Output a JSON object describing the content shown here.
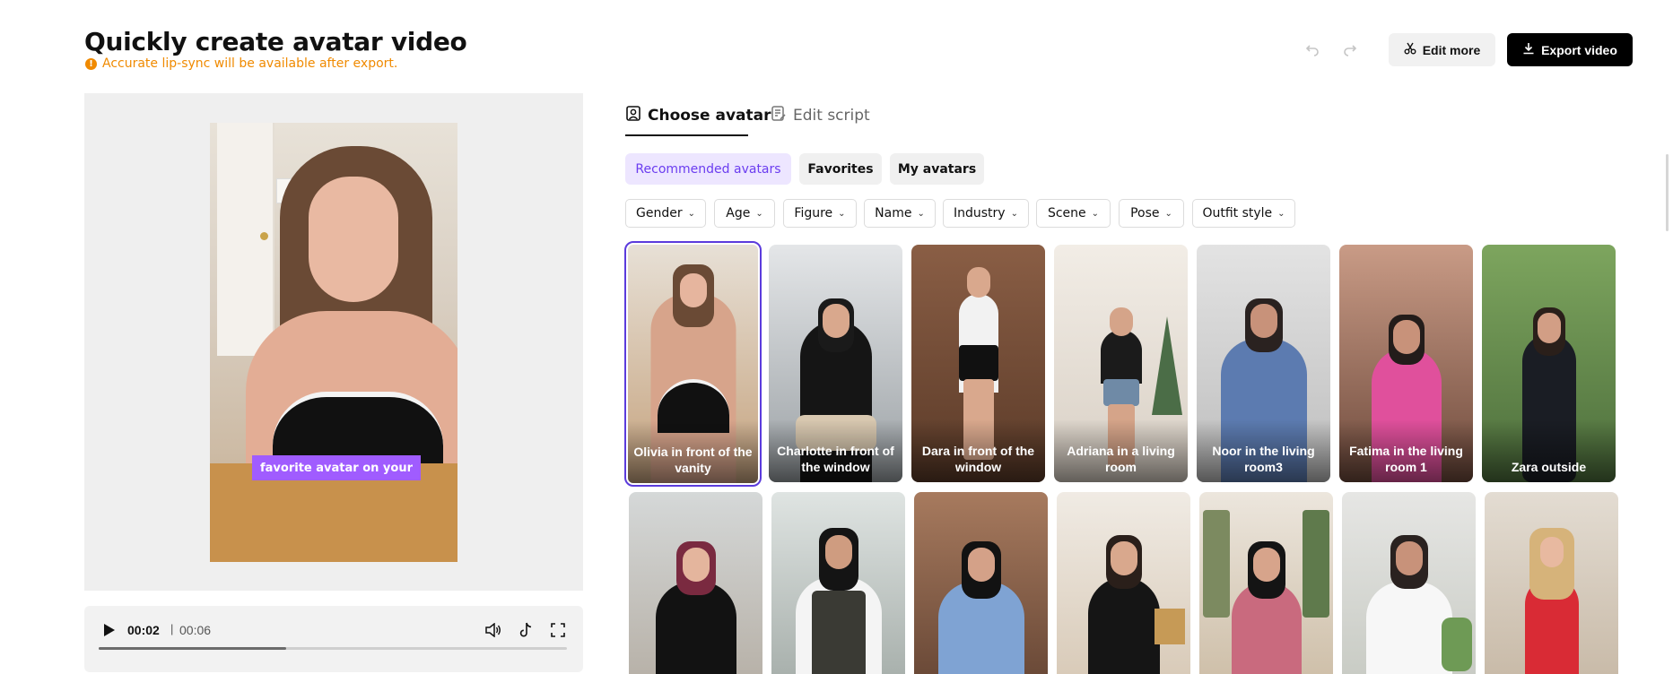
{
  "header": {
    "title": "Quickly create avatar video",
    "notice": "Accurate lip-sync will be available after export.",
    "notice_icon": "info-icon",
    "edit_more_label": "Edit more",
    "export_label": "Export video",
    "accent_color": "#f08a00"
  },
  "preview": {
    "caption": "favorite avatar on your"
  },
  "player": {
    "current_time": "00:02",
    "separator": "|",
    "total_time": "00:06",
    "progress": 0.4
  },
  "tabs": [
    {
      "label": "Choose avatar",
      "icon": "avatar-icon",
      "active": true
    },
    {
      "label": "Edit script",
      "icon": "script-icon",
      "active": false
    }
  ],
  "chips": [
    {
      "label": "Recommended avatars",
      "active": true
    },
    {
      "label": "Favorites",
      "active": false
    },
    {
      "label": "My avatars",
      "active": false
    }
  ],
  "filters": [
    "Gender",
    "Age",
    "Figure",
    "Name",
    "Industry",
    "Scene",
    "Pose",
    "Outfit style"
  ],
  "avatars_row1": [
    {
      "label": "Olivia in front of the vanity",
      "selected": true
    },
    {
      "label": "Charlotte in front of the window",
      "selected": false
    },
    {
      "label": "Dara in front of the window",
      "selected": false
    },
    {
      "label": "Adriana in a living room",
      "selected": false
    },
    {
      "label": "Noor in the living room3",
      "selected": false
    },
    {
      "label": "Fatima in the living room 1",
      "selected": false
    },
    {
      "label": "Zara outside",
      "selected": false
    }
  ],
  "avatars_row2_count": 7,
  "selected_color": "#5b3bdc"
}
